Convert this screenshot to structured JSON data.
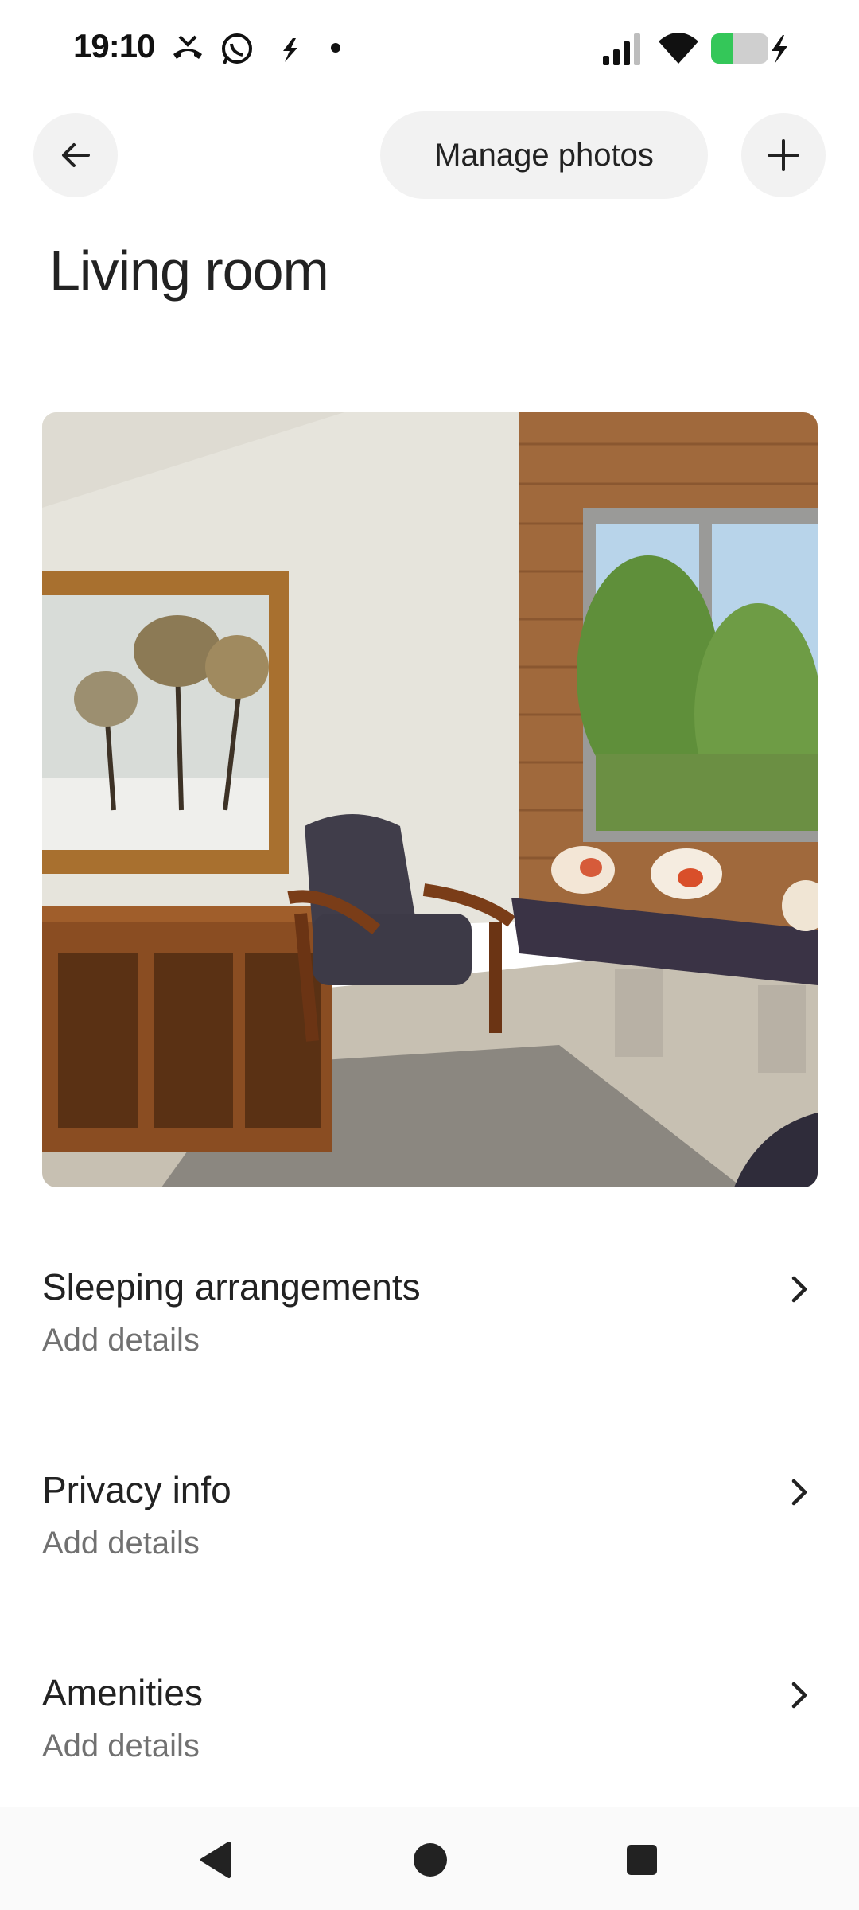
{
  "status_bar": {
    "time": "19:10",
    "icons": [
      "missed-call-icon",
      "whatsapp-icon",
      "bolt-app-icon",
      "dot-icon",
      "signal-icon",
      "wifi-icon",
      "battery-charging-icon"
    ],
    "battery_color": "#34c759"
  },
  "header": {
    "back_icon": "arrow-left-icon",
    "manage_photos_label": "Manage photos",
    "add_icon": "plus-icon"
  },
  "page": {
    "title": "Living room"
  },
  "photo": {
    "subject": "living-room-photo"
  },
  "sections": [
    {
      "title": "Sleeping arrangements",
      "subtitle": "Add details"
    },
    {
      "title": "Privacy info",
      "subtitle": "Add details"
    },
    {
      "title": "Amenities",
      "subtitle": "Add details"
    }
  ],
  "nav": {
    "icons": [
      "back-triangle-icon",
      "home-circle-icon",
      "recents-square-icon"
    ]
  }
}
